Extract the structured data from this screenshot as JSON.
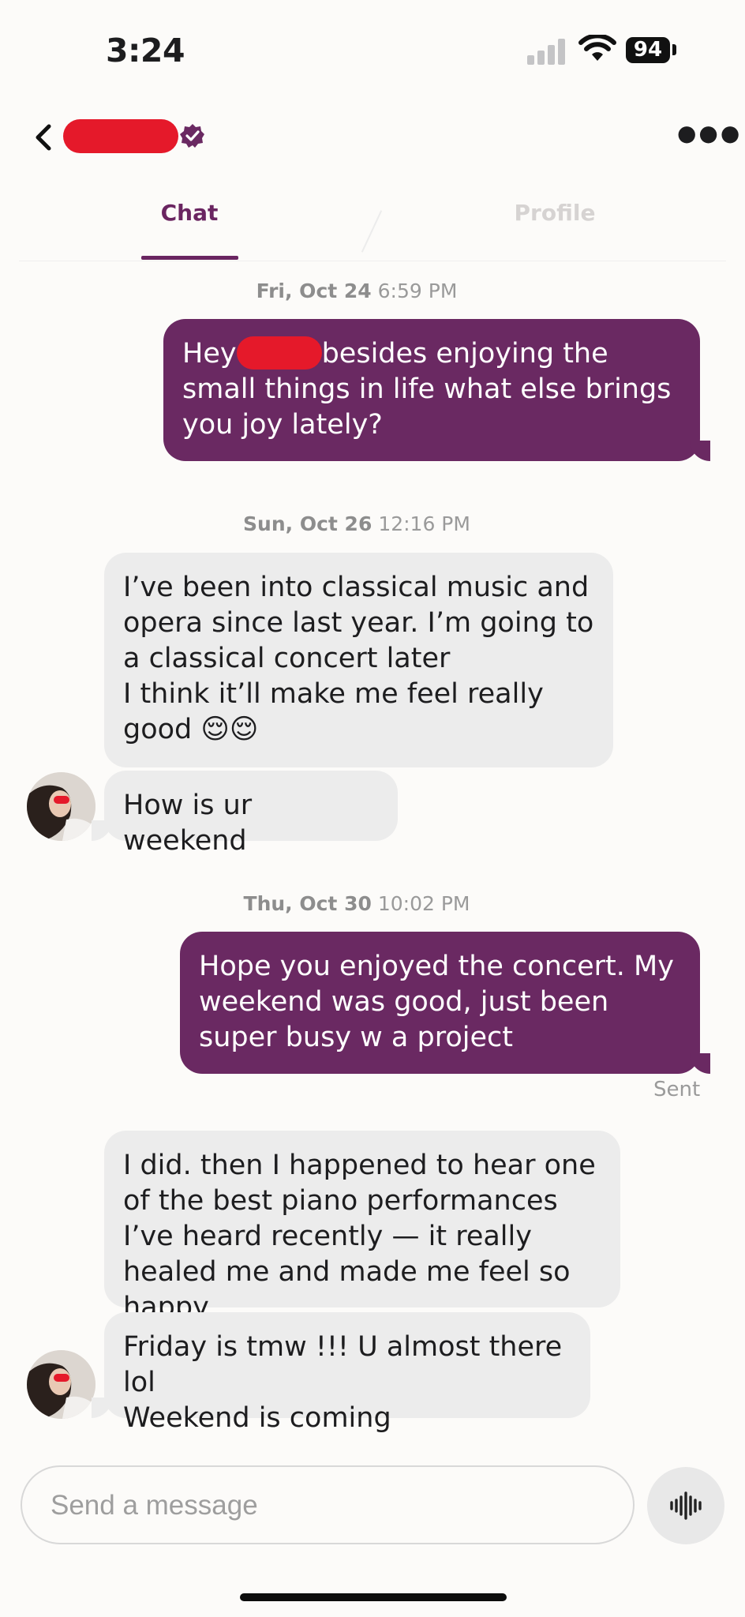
{
  "status_bar": {
    "time": "3:24",
    "battery": "94"
  },
  "tabs": {
    "chat": "Chat",
    "profile": "Profile"
  },
  "composer": {
    "placeholder": "Send a message"
  },
  "messages": {
    "d1": {
      "day": "Fri, Oct 24",
      "time": "6:59 PM"
    },
    "m1a": "Hey",
    "m1b": "besides enjoying the small things in life what else brings you joy lately?",
    "d2": {
      "day": "Sun, Oct 26",
      "time": "12:16 PM"
    },
    "m2": "I’ve been into classical music and opera since last year. I’m going to a classical concert later\nI think it’ll make me feel really good 😌😌",
    "m3": "How is ur weekend",
    "d3": {
      "day": "Thu, Oct 30",
      "time": "10:02 PM"
    },
    "m4": "Hope you enjoyed the concert. My weekend was good, just been super busy w a project",
    "sent": "Sent",
    "m5": "I did. then I happened to hear one of the best piano performances I’ve heard recently — it really healed me and made me feel so happy.",
    "m6": "Friday is tmw !!! U almost there lol\nWeekend is coming"
  },
  "icons": {
    "back": "chevron-left-icon",
    "verified": "verified-badge-icon",
    "more": "more-horizontal-icon",
    "voice": "voice-waveform-icon"
  },
  "colors": {
    "brand": "#6a2962",
    "redaction": "#e5192a",
    "incoming_bubble": "#ececec"
  }
}
